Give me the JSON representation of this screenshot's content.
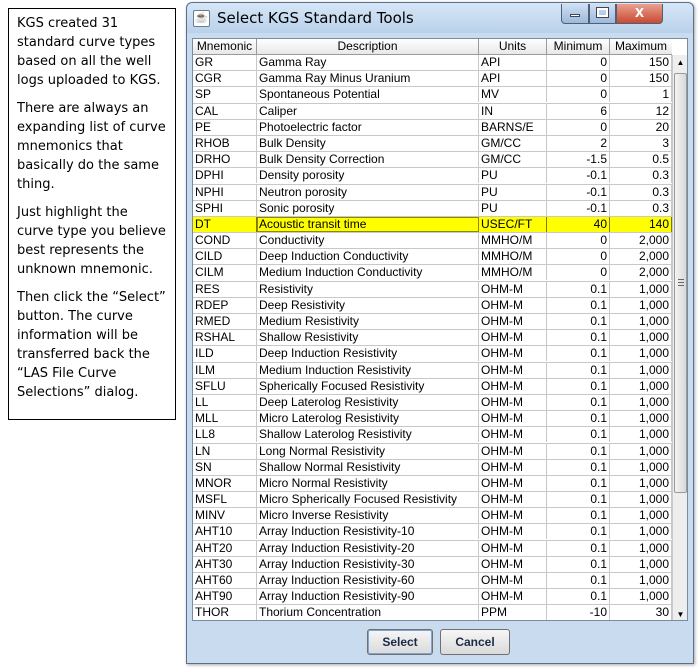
{
  "note": {
    "paragraphs": [
      "KGS created 31 standard curve types based on all the well logs uploaded to KGS.",
      "There are always an expanding list of curve mnemonics that basically do the same thing.",
      "Just highlight the curve type you believe best represents the unknown mnemonic.",
      "Then click the “Select” button. The curve information will be transferred back the “LAS File Curve Selections” dialog."
    ]
  },
  "window": {
    "title": "Select KGS Standard Tools",
    "close_glyph": "X"
  },
  "table": {
    "headers": [
      "Mnemonic",
      "Description",
      "Units",
      "Minimum",
      "Maximum"
    ],
    "selected_index": 10,
    "rows": [
      [
        "GR",
        "Gamma Ray",
        "API",
        "0",
        "150"
      ],
      [
        "CGR",
        "Gamma Ray Minus Uranium",
        "API",
        "0",
        "150"
      ],
      [
        "SP",
        "Spontaneous Potential",
        "MV",
        "0",
        "1"
      ],
      [
        "CAL",
        "Caliper",
        "IN",
        "6",
        "12"
      ],
      [
        "PE",
        "Photoelectric factor",
        "BARNS/E",
        "0",
        "20"
      ],
      [
        "RHOB",
        "Bulk Density",
        "GM/CC",
        "2",
        "3"
      ],
      [
        "DRHO",
        "Bulk Density Correction",
        "GM/CC",
        "-1.5",
        "0.5"
      ],
      [
        "DPHI",
        "Density porosity",
        "PU",
        "-0.1",
        "0.3"
      ],
      [
        "NPHI",
        "Neutron porosity",
        "PU",
        "-0.1",
        "0.3"
      ],
      [
        "SPHI",
        "Sonic porosity",
        "PU",
        "-0.1",
        "0.3"
      ],
      [
        "DT",
        "Acoustic transit time",
        "USEC/FT",
        "40",
        "140"
      ],
      [
        "COND",
        "Conductivity",
        "MMHO/M",
        "0",
        "2,000"
      ],
      [
        "CILD",
        "Deep Induction Conductivity",
        "MMHO/M",
        "0",
        "2,000"
      ],
      [
        "CILM",
        "Medium Induction Conductivity",
        "MMHO/M",
        "0",
        "2,000"
      ],
      [
        "RES",
        "Resistivity",
        "OHM-M",
        "0.1",
        "1,000"
      ],
      [
        "RDEP",
        "Deep Resistivity",
        "OHM-M",
        "0.1",
        "1,000"
      ],
      [
        "RMED",
        "Medium Resistivity",
        "OHM-M",
        "0.1",
        "1,000"
      ],
      [
        "RSHAL",
        "Shallow Resistivity",
        "OHM-M",
        "0.1",
        "1,000"
      ],
      [
        "ILD",
        "Deep Induction Resistivity",
        "OHM-M",
        "0.1",
        "1,000"
      ],
      [
        "ILM",
        "Medium Induction Resistivity",
        "OHM-M",
        "0.1",
        "1,000"
      ],
      [
        "SFLU",
        "Spherically Focused Resistivity",
        "OHM-M",
        "0.1",
        "1,000"
      ],
      [
        "LL",
        "Deep Laterolog Resistivity",
        "OHM-M",
        "0.1",
        "1,000"
      ],
      [
        "MLL",
        "Micro Laterolog Resistivity",
        "OHM-M",
        "0.1",
        "1,000"
      ],
      [
        "LL8",
        "Shallow Laterolog Resistivity",
        "OHM-M",
        "0.1",
        "1,000"
      ],
      [
        "LN",
        "Long Normal Resistivity",
        "OHM-M",
        "0.1",
        "1,000"
      ],
      [
        "SN",
        "Shallow Normal Resistivity",
        "OHM-M",
        "0.1",
        "1,000"
      ],
      [
        "MNOR",
        "Micro Normal Resistivity",
        "OHM-M",
        "0.1",
        "1,000"
      ],
      [
        "MSFL",
        "Micro Spherically Focused Resistivity",
        "OHM-M",
        "0.1",
        "1,000"
      ],
      [
        "MINV",
        "Micro Inverse Resistivity",
        "OHM-M",
        "0.1",
        "1,000"
      ],
      [
        "AHT10",
        "Array Induction Resistivity-10",
        "OHM-M",
        "0.1",
        "1,000"
      ],
      [
        "AHT20",
        "Array Induction Resistivity-20",
        "OHM-M",
        "0.1",
        "1,000"
      ],
      [
        "AHT30",
        "Array Induction Resistivity-30",
        "OHM-M",
        "0.1",
        "1,000"
      ],
      [
        "AHT60",
        "Array Induction Resistivity-60",
        "OHM-M",
        "0.1",
        "1,000"
      ],
      [
        "AHT90",
        "Array Induction Resistivity-90",
        "OHM-M",
        "0.1",
        "1,000"
      ],
      [
        "THOR",
        "Thorium Concentration",
        "PPM",
        "-10",
        "30"
      ]
    ]
  },
  "buttons": {
    "select_label": "Select",
    "cancel_label": "Cancel"
  },
  "colors": {
    "selected_row": "#ffff00",
    "dialog_frame": "#c9dbee",
    "close_button": "#c74a33"
  },
  "icons": {
    "app": "java-coffee-icon",
    "minimize": "minimize-icon",
    "maximize": "maximize-icon",
    "close": "close-icon",
    "scroll_up": "arrow-up-icon",
    "scroll_down": "arrow-down-icon"
  }
}
